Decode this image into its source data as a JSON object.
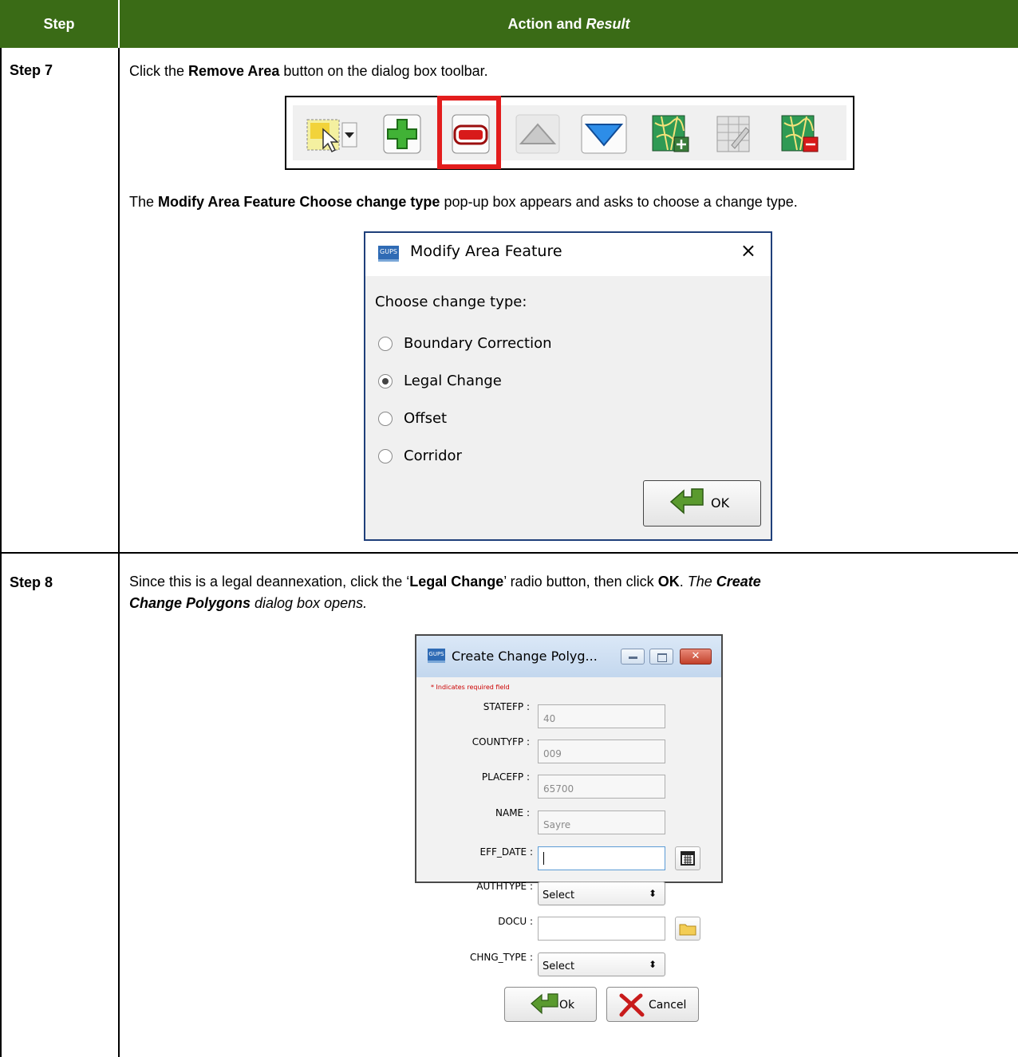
{
  "table": {
    "col_step": "Step",
    "col_action": "Action and",
    "col_result": "Result"
  },
  "step7": {
    "label": "Step 7",
    "line1_pre": "Click the ",
    "line1_bold": "Remove Area",
    "line1_post": " button on the dialog box toolbar.",
    "line2_pre": "The ",
    "line2_bold": "Modify Area Feature Choose change type",
    "line2_post": " pop-up box appears and asks to choose a change type."
  },
  "toolbar": {
    "buttons": [
      "select-features-icon",
      "add-area-icon",
      "remove-area-icon",
      "move-up-icon",
      "move-down-icon",
      "add-map-icon",
      "edit-table-icon",
      "remove-map-icon"
    ],
    "highlight_color": "#e31d1d"
  },
  "modify_dialog": {
    "title": "Modify Area Feature",
    "logo": "GUPS",
    "close": "×",
    "prompt": "Choose change type:",
    "options": [
      "Boundary Correction",
      "Legal Change",
      "Offset",
      "Corridor"
    ],
    "selected": "Legal Change",
    "ok_label": "OK"
  },
  "step8": {
    "label": "Step 8",
    "t1": "Since this is a legal deannexation, click the ‘",
    "t2": "Legal Change",
    "t3": "’ radio button, then click ",
    "t4": "OK",
    "t5": ". ",
    "t6": "The ",
    "t7": "Create",
    "t8": "Change Polygons",
    "t9": " dialog box opens."
  },
  "create_dialog": {
    "title": "Create Change Polyg...",
    "logo": "GUPS",
    "required_note": "* Indicates required field",
    "fields": [
      {
        "label": "STATEFP :",
        "value": "40"
      },
      {
        "label": "COUNTYFP :",
        "value": "009"
      },
      {
        "label": "PLACEFP :",
        "value": "65700"
      },
      {
        "label": "NAME :",
        "value": "Sayre"
      }
    ],
    "eff_date_label": "EFF_DATE :",
    "authtype_label": "AUTHTYPE :",
    "authtype_value": "Select",
    "docu_label": "DOCU :",
    "chng_type_label": "CHNG_TYPE :",
    "chng_type_value": "Select",
    "ok_label": "Ok",
    "cancel_label": "Cancel"
  }
}
